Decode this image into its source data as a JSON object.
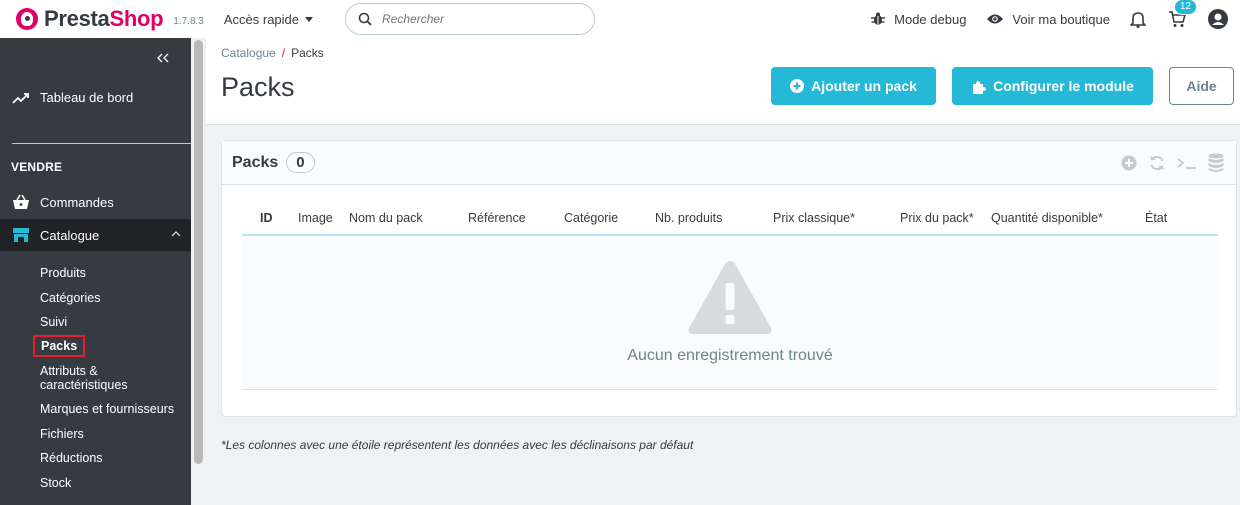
{
  "header": {
    "logo_text_presta": "Presta",
    "logo_text_shop": "Shop",
    "version": "1.7.8.3",
    "quick_access": "Accès rapide",
    "search_placeholder": "Rechercher",
    "debug_label": "Mode debug",
    "view_shop_label": "Voir ma boutique",
    "orders_badge": "12"
  },
  "sidebar": {
    "dashboard": "Tableau de bord",
    "section_sell": "VENDRE",
    "orders": "Commandes",
    "catalog": "Catalogue",
    "catalog_items": [
      "Produits",
      "Catégories",
      "Suivi",
      "Packs",
      "Attributs &",
      "caractéristiques",
      "Marques et fournisseurs",
      "Fichiers",
      "Réductions",
      "Stock"
    ]
  },
  "page": {
    "breadcrumb_parent": "Catalogue",
    "breadcrumb_sep": "/",
    "breadcrumb_current": "Packs",
    "title": "Packs",
    "btn_add": "Ajouter un pack",
    "btn_configure": "Configurer le module",
    "btn_help": "Aide"
  },
  "panel": {
    "title": "Packs",
    "count": "0",
    "columns": [
      "ID",
      "Image",
      "Nom du pack",
      "Référence",
      "Catégorie",
      "Nb. produits",
      "Prix classique*",
      "Prix du pack*",
      "Quantité disponible*",
      "État"
    ],
    "empty_text": "Aucun enregistrement trouvé"
  },
  "footnote": "*Les colonnes avec une étoile représentent les données avec les déclinaisons par défaut",
  "colors": {
    "accent": "#25b9d7",
    "brand": "#df0067",
    "sidebar": "#363a41",
    "highlight_box": "#e5202d"
  }
}
